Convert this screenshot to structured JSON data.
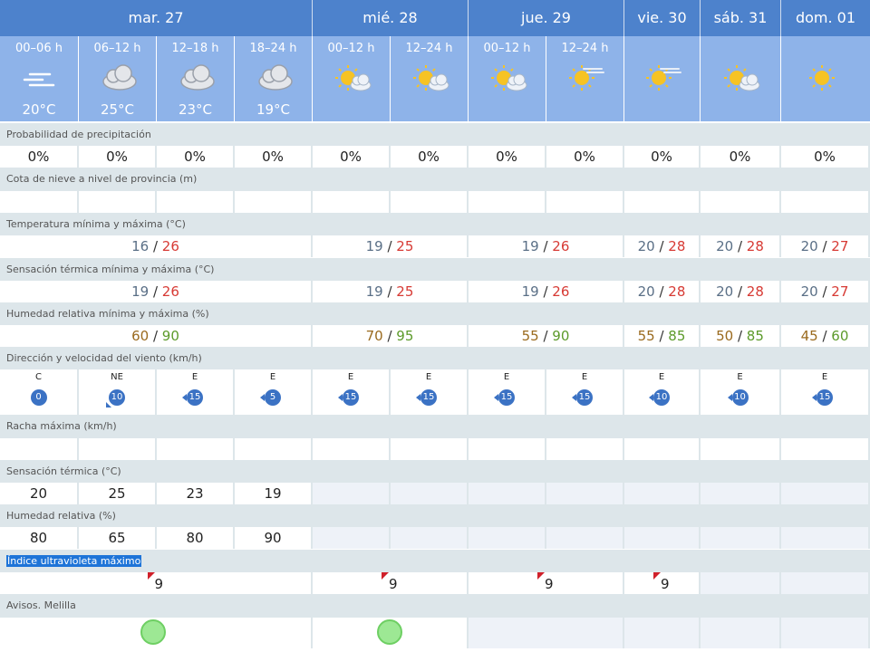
{
  "days": [
    {
      "label": "mar. 27"
    },
    {
      "label": "mié. 28"
    },
    {
      "label": "jue. 29"
    },
    {
      "label": "vie. 30"
    },
    {
      "label": "sáb. 31"
    },
    {
      "label": "dom. 01"
    }
  ],
  "periods": [
    {
      "label": "00–06 h",
      "icon": "haze-icon",
      "temp": "20°C"
    },
    {
      "label": "06–12 h",
      "icon": "cloud-icon",
      "temp": "25°C"
    },
    {
      "label": "12–18 h",
      "icon": "cloud-icon",
      "temp": "23°C"
    },
    {
      "label": "18–24 h",
      "icon": "cloud-icon",
      "temp": "19°C"
    },
    {
      "label": "00–12 h",
      "icon": "sun-cloud-icon",
      "temp": ""
    },
    {
      "label": "12–24 h",
      "icon": "sun-cloud-icon",
      "temp": ""
    },
    {
      "label": "00–12 h",
      "icon": "sun-cloud-icon",
      "temp": ""
    },
    {
      "label": "12–24 h",
      "icon": "sun-haze-icon",
      "temp": ""
    },
    {
      "label": "",
      "icon": "sun-haze-icon",
      "temp": ""
    },
    {
      "label": "",
      "icon": "sun-cloud-icon",
      "temp": ""
    },
    {
      "label": "",
      "icon": "sun-icon",
      "temp": ""
    }
  ],
  "labels": {
    "precip": "Probabilidad de precipitación",
    "snow": "Cota de nieve a nivel de provincia (m)",
    "temp_minmax": "Temperatura mínima y máxima (°C)",
    "feel_minmax": "Sensación térmica mínima y máxima (°C)",
    "hum_minmax": "Humedad relativa mínima y máxima (%)",
    "wind": "Dirección y velocidad del viento (km/h)",
    "gust": "Racha máxima (km/h)",
    "feel": "Sensación térmica (°C)",
    "hum": "Humedad relativa (%)",
    "uv": "Índice ultravioleta máximo",
    "avisos": "Avisos. Melilla"
  },
  "precip": [
    "0%",
    "0%",
    "0%",
    "0%",
    "0%",
    "0%",
    "0%",
    "0%",
    "0%",
    "0%",
    "0%"
  ],
  "temp_minmax": [
    {
      "min": "16",
      "max": "26"
    },
    {
      "min": "19",
      "max": "25"
    },
    {
      "min": "19",
      "max": "26"
    },
    {
      "min": "20",
      "max": "28"
    },
    {
      "min": "20",
      "max": "28"
    },
    {
      "min": "20",
      "max": "27"
    }
  ],
  "feel_minmax": [
    {
      "min": "19",
      "max": "26"
    },
    {
      "min": "19",
      "max": "25"
    },
    {
      "min": "19",
      "max": "26"
    },
    {
      "min": "20",
      "max": "28"
    },
    {
      "min": "20",
      "max": "28"
    },
    {
      "min": "20",
      "max": "27"
    }
  ],
  "hum_minmax": [
    {
      "min": "60",
      "max": "90"
    },
    {
      "min": "70",
      "max": "95"
    },
    {
      "min": "55",
      "max": "90"
    },
    {
      "min": "55",
      "max": "85"
    },
    {
      "min": "50",
      "max": "85"
    },
    {
      "min": "45",
      "max": "60"
    }
  ],
  "wind": [
    {
      "dir": "C",
      "speed": "0"
    },
    {
      "dir": "NE",
      "speed": "10"
    },
    {
      "dir": "E",
      "speed": "15"
    },
    {
      "dir": "E",
      "speed": "5"
    },
    {
      "dir": "E",
      "speed": "15"
    },
    {
      "dir": "E",
      "speed": "15"
    },
    {
      "dir": "E",
      "speed": "15"
    },
    {
      "dir": "E",
      "speed": "15"
    },
    {
      "dir": "E",
      "speed": "10"
    },
    {
      "dir": "E",
      "speed": "10"
    },
    {
      "dir": "E",
      "speed": "15"
    }
  ],
  "feel": [
    "20",
    "25",
    "23",
    "19"
  ],
  "hum": [
    "80",
    "65",
    "80",
    "90"
  ],
  "uv": [
    "9",
    "9",
    "9",
    "9"
  ],
  "colors": {
    "header": "#4d82cc",
    "period": "#8eb3e9",
    "label_row": "#dde6ea",
    "tmax": "#d73a34",
    "hmax": "#5c9a2a",
    "aviso_green": "#9de894"
  }
}
